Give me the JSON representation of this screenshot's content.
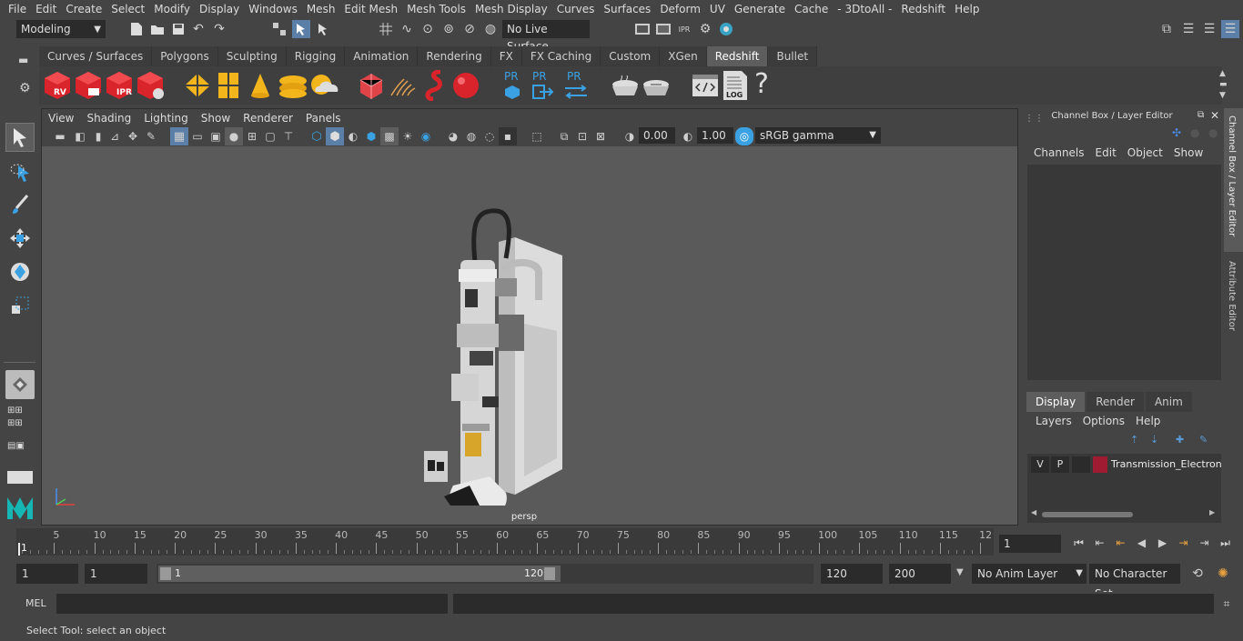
{
  "menubar": {
    "items": [
      "File",
      "Edit",
      "Create",
      "Select",
      "Modify",
      "Display",
      "Windows",
      "Mesh",
      "Edit Mesh",
      "Mesh Tools",
      "Mesh Display",
      "Curves",
      "Surfaces",
      "Deform",
      "UV",
      "Generate",
      "Cache",
      "- 3DtoAll -",
      "Redshift",
      "Help"
    ]
  },
  "statusline": {
    "mode": "Modeling",
    "live_surface": "No Live Surface"
  },
  "shelf": {
    "tabs": [
      "Curves / Surfaces",
      "Polygons",
      "Sculpting",
      "Rigging",
      "Animation",
      "Rendering",
      "FX",
      "FX Caching",
      "Custom",
      "XGen",
      "Redshift",
      "Bullet"
    ],
    "active_tab": "Redshift",
    "icon_labels": {
      "rv": "RV",
      "ipr": "IPR",
      "pr1": "PR",
      "pr2": "PR",
      "pr3": "PR",
      "log": "LOG",
      "help": "?"
    }
  },
  "viewport": {
    "menu": [
      "View",
      "Shading",
      "Lighting",
      "Show",
      "Renderer",
      "Panels"
    ],
    "exposure": "0.00",
    "gamma": "1.00",
    "color_space": "sRGB gamma",
    "camera_label": "persp"
  },
  "channelbox": {
    "title": "Channel Box / Layer Editor",
    "menu": [
      "Channels",
      "Edit",
      "Object",
      "Show"
    ],
    "side_tabs": [
      "Channel Box / Layer Editor",
      "Attribute Editor"
    ]
  },
  "layereditor": {
    "tabs": [
      "Display",
      "Render",
      "Anim"
    ],
    "active_tab": "Display",
    "menu": [
      "Layers",
      "Options",
      "Help"
    ],
    "layer": {
      "visible": "V",
      "playback": "P",
      "name": "Transmission_Electron",
      "color": "#9e1b32"
    }
  },
  "timeslider": {
    "ticks": [
      "5",
      "10",
      "15",
      "20",
      "25",
      "30",
      "35",
      "40",
      "45",
      "50",
      "55",
      "60",
      "65",
      "70",
      "75",
      "80",
      "85",
      "90",
      "95",
      "100",
      "105",
      "110",
      "115",
      "12"
    ],
    "start_label": "1",
    "current_frame": "1"
  },
  "rangeslider": {
    "start_frame": "1",
    "start_anim": "1",
    "range_start": "1",
    "range_end": "120",
    "end_anim": "120",
    "end_frame": "200",
    "anim_layer": "No Anim Layer",
    "character_set": "No Character Set"
  },
  "cmdline": {
    "label": "MEL"
  },
  "helpline": {
    "text": "Select Tool: select an object"
  }
}
